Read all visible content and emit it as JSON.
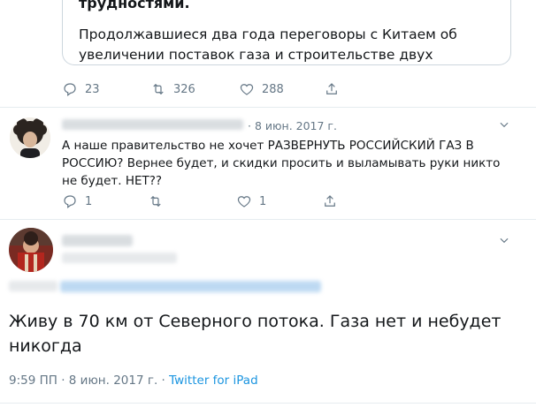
{
  "quoted_tweet": {
    "line1": "трудностями.",
    "line2": "Продолжавшиеся два года переговоры с Китаем об",
    "line3": "увеличении поставок газа и строительстве двух"
  },
  "first_tweet_actions": {
    "reply_count": "23",
    "retweet_count": "326",
    "like_count": "288"
  },
  "reply": {
    "date": "· 8 июн. 2017 г.",
    "text": "А наше правительство не хочет РАЗВЕРНУТЬ РОССИЙСКИЙ ГАЗ В РОССИЮ? Вернее будет, и скидки просить и выламывать руки никто не будет. НЕТ??",
    "reply_count": "1",
    "retweet_count": "",
    "like_count": "1"
  },
  "main_tweet": {
    "replying_fragment": "rk... a @vi...",
    "text": "Живу в 70 км от Северного потока. Газа нет и небудет никогда",
    "time": "9:59 ПП · 8 июн. 2017 г. · ",
    "source": "Twitter for iPad"
  },
  "colors": {
    "accent": "#1b95e0",
    "muted": "#657786",
    "divider": "#e6ecf0"
  }
}
